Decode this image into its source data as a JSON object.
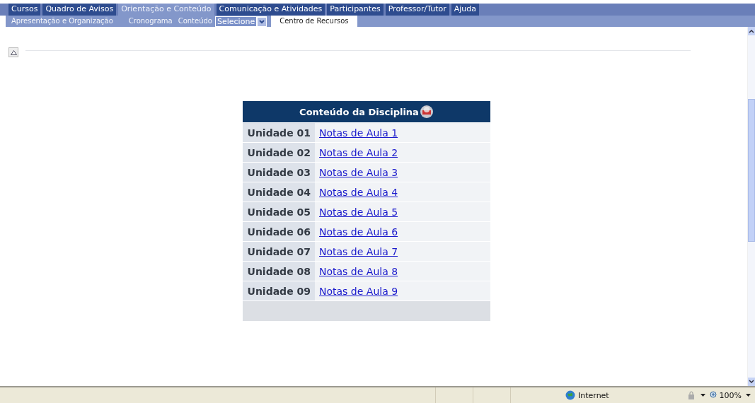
{
  "main_tabs": [
    {
      "label": "Cursos",
      "selected": false
    },
    {
      "label": "Quadro de Avisos",
      "selected": false
    },
    {
      "label": "Orientação e Conteúdo",
      "selected": true
    },
    {
      "label": "Comunicação e Atividades",
      "selected": false
    },
    {
      "label": "Participantes",
      "selected": false
    },
    {
      "label": "Professor/Tutor",
      "selected": false
    },
    {
      "label": "Ajuda",
      "selected": false
    }
  ],
  "sub_nav": [
    {
      "kind": "link",
      "label": "Apresentação e Organização",
      "selected": false
    },
    {
      "kind": "link",
      "label": "Cronograma",
      "selected": false
    },
    {
      "kind": "link",
      "label": "Conteúdo",
      "selected": false
    },
    {
      "kind": "select",
      "label": "Selecione"
    },
    {
      "kind": "link",
      "label": "Centro de Recursos",
      "selected": true
    }
  ],
  "content_table": {
    "title": "Conteúdo da Disciplina",
    "rows": [
      {
        "unit": "Unidade 01",
        "link": "Notas de Aula 1"
      },
      {
        "unit": "Unidade 02",
        "link": "Notas de Aula 2"
      },
      {
        "unit": "Unidade 03",
        "link": "Notas de Aula 3"
      },
      {
        "unit": "Unidade 04",
        "link": "Notas de Aula 4"
      },
      {
        "unit": "Unidade 05",
        "link": "Notas de Aula 5"
      },
      {
        "unit": "Unidade 06",
        "link": "Notas de Aula 6"
      },
      {
        "unit": "Unidade 07",
        "link": "Notas de Aula 7"
      },
      {
        "unit": "Unidade 08",
        "link": "Notas de Aula 8"
      },
      {
        "unit": "Unidade 09",
        "link": "Notas de Aula 9"
      }
    ]
  },
  "status_bar": {
    "zone": "Internet",
    "zoom": "100%"
  }
}
